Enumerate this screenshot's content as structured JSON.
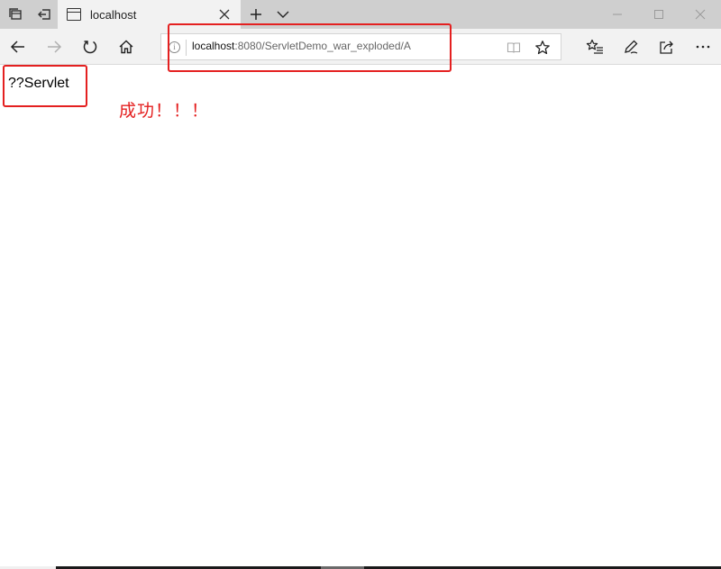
{
  "tab": {
    "title": "localhost"
  },
  "address_bar": {
    "url_host": "localhost",
    "url_rest": ":8080/ServletDemo_war_exploded/A",
    "info_glyph": "i"
  },
  "page": {
    "heading": "??Servlet",
    "note": "成功！！！"
  },
  "icons": {
    "tab_manager": "tabs-aside-icon",
    "set_aside": "set-aside-icon",
    "tab_page": "page-icon",
    "close": "close-icon",
    "new_tab": "plus-icon",
    "tab_dropdown": "chevron-down-icon",
    "minimize": "minimize-icon",
    "maximize": "maximize-icon",
    "window_close": "close-icon",
    "back": "back-arrow-icon",
    "forward": "forward-arrow-icon",
    "refresh": "refresh-icon",
    "home": "home-icon",
    "site_info": "info-icon",
    "reading_view": "book-icon",
    "favorite": "star-icon",
    "favorites_hub": "favorites-list-icon",
    "notes": "pen-icon",
    "share": "share-icon",
    "more": "more-icon"
  },
  "colors": {
    "highlight": "#e42020",
    "note_text": "#e42020",
    "tab_strip": "#cfcfcf",
    "toolbar": "#f2f2f2"
  }
}
